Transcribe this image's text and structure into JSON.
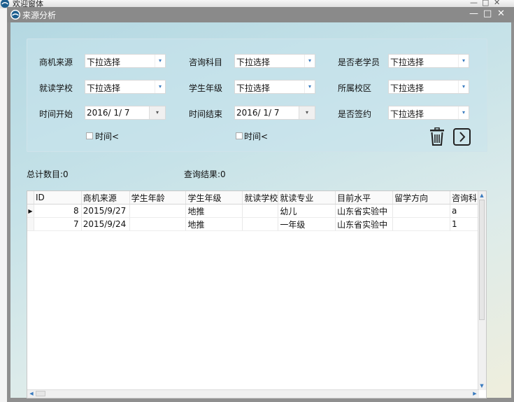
{
  "back_window": {
    "title": "欢迎窗体",
    "controls": [
      "—",
      "□",
      "✕"
    ]
  },
  "window": {
    "title": "来源分析",
    "controls": [
      "—",
      "□",
      "✕"
    ]
  },
  "filters": {
    "source_label": "商机来源",
    "source_value": "下拉选择",
    "subject_label": "咨询科目",
    "subject_value": "下拉选择",
    "old_student_label": "是否老学员",
    "old_student_value": "下拉选择",
    "school_label": "就读学校",
    "school_value": "下拉选择",
    "grade_label": "学生年级",
    "grade_value": "下拉选择",
    "campus_label": "所属校区",
    "campus_value": "下拉选择",
    "time_start_label": "时间开始",
    "time_start_value": "2016/ 1/ 7",
    "time_end_label": "时间结束",
    "time_end_value": "2016/ 1/ 7",
    "signed_label": "是否签约",
    "signed_value": "下拉选择",
    "time_check_1": "时间<",
    "time_check_2": "时间<"
  },
  "summary": {
    "total": "总计数目:0",
    "results": "查询结果:0"
  },
  "table": {
    "columns": [
      "ID",
      "商机来源",
      "学生年龄",
      "学生年级",
      "就读学校",
      "就读专业",
      "目前水平",
      "留学方向",
      "咨询科目"
    ],
    "rows": [
      {
        "selected": true,
        "cells": [
          "8",
          "2015/9/27",
          "",
          "地推",
          "",
          "幼儿",
          "山东省实验中",
          "",
          "a"
        ]
      },
      {
        "selected": false,
        "cells": [
          "7",
          "2015/9/24",
          "",
          "地推",
          "",
          "一年级",
          "山东省实验中",
          "",
          "1"
        ]
      }
    ]
  },
  "icons": {
    "delete": "trash-icon",
    "next": "chevron-right-icon",
    "selector": "row-selector-arrow"
  }
}
